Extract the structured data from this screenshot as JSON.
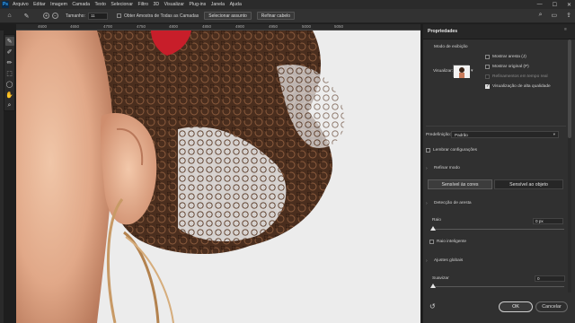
{
  "app": {
    "logo": "Ps"
  },
  "menu": [
    "Arquivo",
    "Editar",
    "Imagem",
    "Camada",
    "Texto",
    "Selecionar",
    "Filtro",
    "3D",
    "Visualizar",
    "Plug-ins",
    "Janela",
    "Ajuda"
  ],
  "options": {
    "size_label": "Tamanho:",
    "size_value": "11",
    "sample_all_layers": "Obter Amostra de Todas as Camadas",
    "select_subject": "Selecionar assunto",
    "refine_hair": "Refinar cabelo"
  },
  "ruler": {
    "ticks": [
      "4600",
      "4650",
      "4700",
      "4750",
      "4800",
      "4850",
      "4900",
      "4950",
      "5000",
      "5050"
    ]
  },
  "tools": [
    "brush-tool-icon",
    "refine-edge-brush-icon",
    "brush-icon",
    "object-select-icon",
    "lasso-icon",
    "hand-icon",
    "zoom-icon"
  ],
  "properties": {
    "title": "Propriedades",
    "view_mode": "Modo de exibição",
    "show_edge": "Mostrar aresta (J)",
    "show_original": "Mostrar original (P)",
    "realtime_refine": "Refinamentos em tempo real",
    "high_quality_preview": "Visualização de alta qualidade",
    "view_label": "Visualizar:",
    "preset_label": "Predefinição:",
    "preset_value": "Padrão",
    "remember_settings": "Lembrar configurações",
    "refine_mode": "Refinar modo",
    "color_aware": "Sensível às cores",
    "object_aware": "Sensível ao objeto",
    "edge_detection": "Detecção de aresta",
    "radius_label": "Raio",
    "radius_value": "0 px",
    "smart_radius": "Raio inteligente",
    "global_refinements": "Ajustes globais",
    "smooth_label": "Suavizar",
    "smooth_value": "0",
    "ok": "OK",
    "cancel": "Cancelar"
  },
  "colors": {
    "accent": "#31a8ff",
    "panel_bg": "#303030",
    "canvas_bg": "#ececec"
  }
}
